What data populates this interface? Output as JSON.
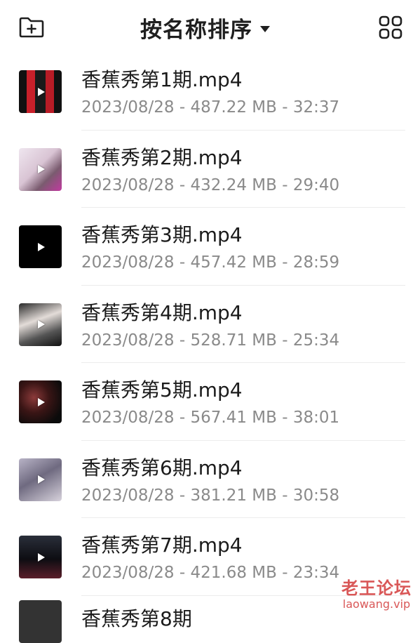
{
  "header": {
    "sort_label": "按名称排序",
    "left_icon": "new-folder-icon",
    "right_icon": "grid-view-icon"
  },
  "files": [
    {
      "name": "香蕉秀第1期.mp4",
      "meta": "2023/08/28 - 487.22 MB - 32:37"
    },
    {
      "name": "香蕉秀第2期.mp4",
      "meta": "2023/08/28 - 432.24 MB - 29:40"
    },
    {
      "name": "香蕉秀第3期.mp4",
      "meta": "2023/08/28 - 457.42 MB - 28:59"
    },
    {
      "name": "香蕉秀第4期.mp4",
      "meta": "2023/08/28 - 528.71 MB - 25:34"
    },
    {
      "name": "香蕉秀第5期.mp4",
      "meta": "2023/08/28 - 567.41 MB - 38:01"
    },
    {
      "name": "香蕉秀第6期.mp4",
      "meta": "2023/08/28 - 381.21 MB - 30:58"
    },
    {
      "name": "香蕉秀第7期.mp4",
      "meta": "2023/08/28 - 421.68 MB - 23:34"
    }
  ],
  "partial_item": {
    "name": "香蕉秀第8期"
  },
  "watermark": {
    "title": "老王论坛",
    "url": "laowang.vip"
  },
  "colors": {
    "text": "#1b1b1b",
    "meta": "#8a8a8a",
    "watermark": "#d33a3a"
  }
}
